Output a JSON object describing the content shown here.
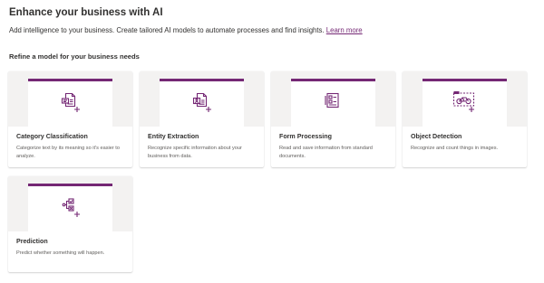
{
  "header": {
    "title": "Enhance your business with AI",
    "subtitle": "Add intelligence to your business. Create tailored AI models to automate processes and find insights.",
    "learn_more": "Learn more"
  },
  "section": {
    "title": "Refine a model for your business needs"
  },
  "colors": {
    "accent": "#742774",
    "card_art_bg": "#f3f2f1"
  },
  "cards": [
    {
      "title": "Category Classification",
      "description": "Categorize text by its meaning so it's easier to analyze.",
      "icon": "category-classification-icon"
    },
    {
      "title": "Entity Extraction",
      "description": "Recognize specific information about your business from data.",
      "icon": "entity-extraction-icon"
    },
    {
      "title": "Form Processing",
      "description": "Read and save information from standard documents.",
      "icon": "form-processing-icon"
    },
    {
      "title": "Object Detection",
      "description": "Recognize and count things in images.",
      "icon": "object-detection-icon"
    },
    {
      "title": "Prediction",
      "description": "Predict whether something will happen.",
      "icon": "prediction-icon"
    }
  ]
}
